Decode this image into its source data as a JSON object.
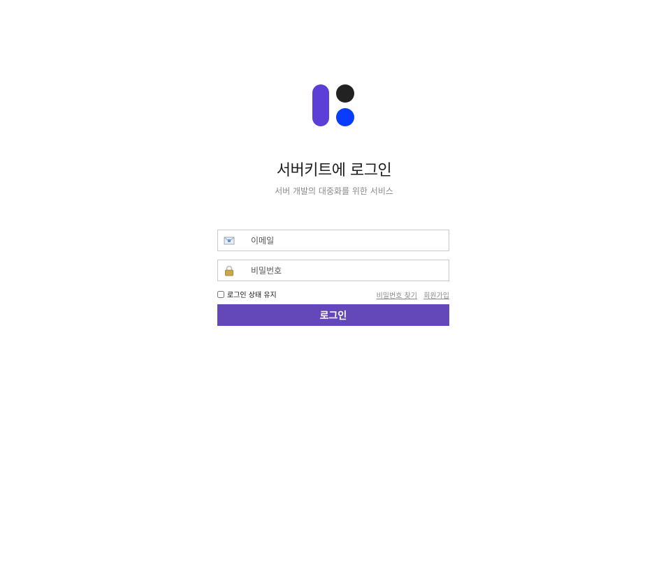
{
  "brand": {
    "logo_icon": "servicekit-logo-icon",
    "colors": {
      "bar": "#5b3fd6",
      "dot_top": "#222222",
      "dot_bottom": "#0a3cff"
    }
  },
  "header": {
    "title": "서버키트에 로그인",
    "subtitle": "서버 개발의 대중화를 위한 서비스"
  },
  "form": {
    "email": {
      "icon": "mail-icon",
      "placeholder": "이메일",
      "value": ""
    },
    "password": {
      "icon": "lock-icon",
      "placeholder": "비밀번호",
      "value": ""
    },
    "remember_label": "로그인 상태 유지",
    "remember_checked": false,
    "find_password_label": "비밀번호 찾기",
    "signup_label": "회원가입",
    "submit_label": "로그인"
  },
  "colors": {
    "accent": "#6448b9"
  }
}
